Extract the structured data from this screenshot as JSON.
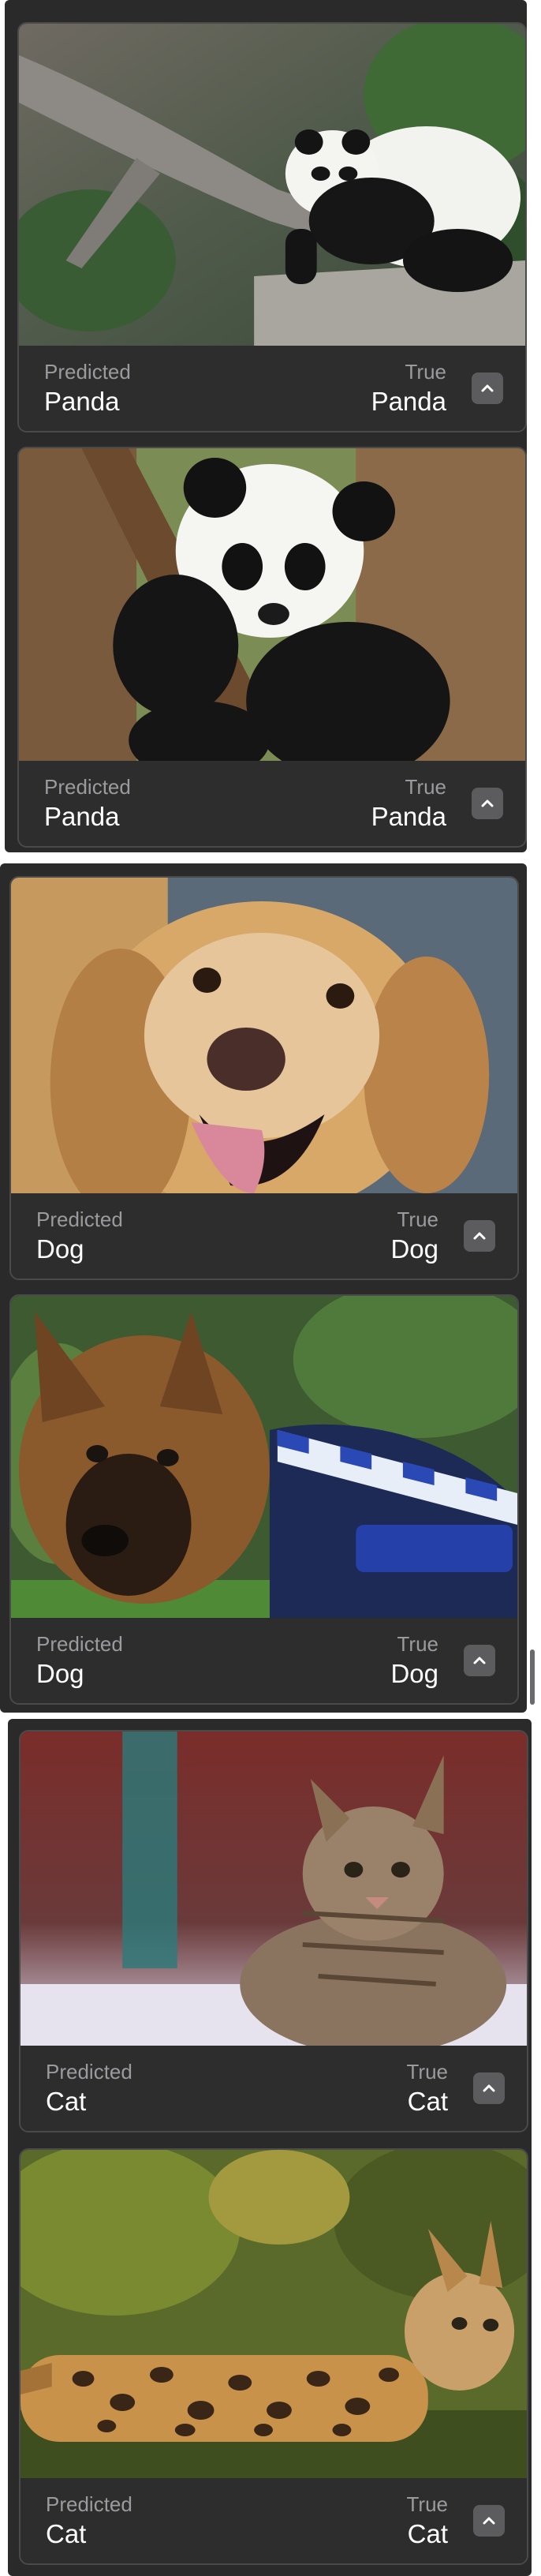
{
  "groups": [
    {
      "class": "Panda",
      "cards": [
        {
          "predicted_caption": "Predicted",
          "predicted": "Panda",
          "true_caption": "True",
          "true": "Panda",
          "image": "panda-on-branch"
        },
        {
          "predicted_caption": "Predicted",
          "predicted": "Panda",
          "true_caption": "True",
          "true": "Panda",
          "image": "panda-hugging-tree"
        }
      ]
    },
    {
      "class": "Dog",
      "cards": [
        {
          "predicted_caption": "Predicted",
          "predicted": "Dog",
          "true_caption": "True",
          "true": "Dog",
          "image": "golden-retriever"
        },
        {
          "predicted_caption": "Predicted",
          "predicted": "Dog",
          "true_caption": "True",
          "true": "Dog",
          "image": "police-puppy"
        }
      ]
    },
    {
      "class": "Cat",
      "cards": [
        {
          "predicted_caption": "Predicted",
          "predicted": "Cat",
          "true_caption": "True",
          "true": "Cat",
          "image": "tabby-kitten"
        },
        {
          "predicted_caption": "Predicted",
          "predicted": "Cat",
          "true_caption": "True",
          "true": "Cat",
          "image": "bengal-cat"
        }
      ]
    }
  ],
  "icons": {
    "expand_button": "chevron-up-icon"
  },
  "colors": {
    "panel_bg": "#2a2a2b",
    "card_border": "#4a4a4b",
    "caption": "#9b9b9d",
    "value": "#ffffff",
    "button_bg": "#5c5c5e"
  }
}
